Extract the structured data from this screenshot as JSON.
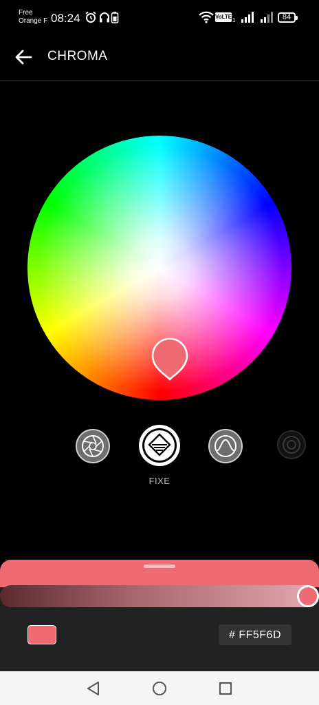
{
  "status_bar": {
    "carrier_line1": "Free",
    "carrier_line2": "Orange F",
    "time": "08:24",
    "icons": [
      "alarm-icon",
      "headphones-icon",
      "battery-saver-icon",
      "wifi-icon",
      "volte-icon",
      "signal-icon",
      "signal-icon"
    ],
    "volte_label": "VoLTE",
    "sim_index": "1",
    "battery_level": "84"
  },
  "app_bar": {
    "title": "CHROMA",
    "back_icon": "arrow-left-icon"
  },
  "color_wheel": {
    "picker_color": "#EF6B74"
  },
  "modes": {
    "items": [
      {
        "icon": "aperture-icon",
        "selected": false
      },
      {
        "icon": "diamond-layers-icon",
        "selected": true
      },
      {
        "icon": "bell-curve-icon",
        "selected": false
      },
      {
        "icon": "ring-icon",
        "selected": false
      }
    ],
    "selected_label": "FIXE"
  },
  "bottom_panel": {
    "slider_value": 1.0,
    "swatch_color": "#EF6B74",
    "hex_value": "# FF5F6D"
  },
  "nav_bar": {
    "icons": [
      "back-triangle-icon",
      "home-circle-icon",
      "recents-square-icon"
    ]
  },
  "colors": {
    "accent": "#EF6B74",
    "background": "#000000",
    "panel": "#222222"
  }
}
